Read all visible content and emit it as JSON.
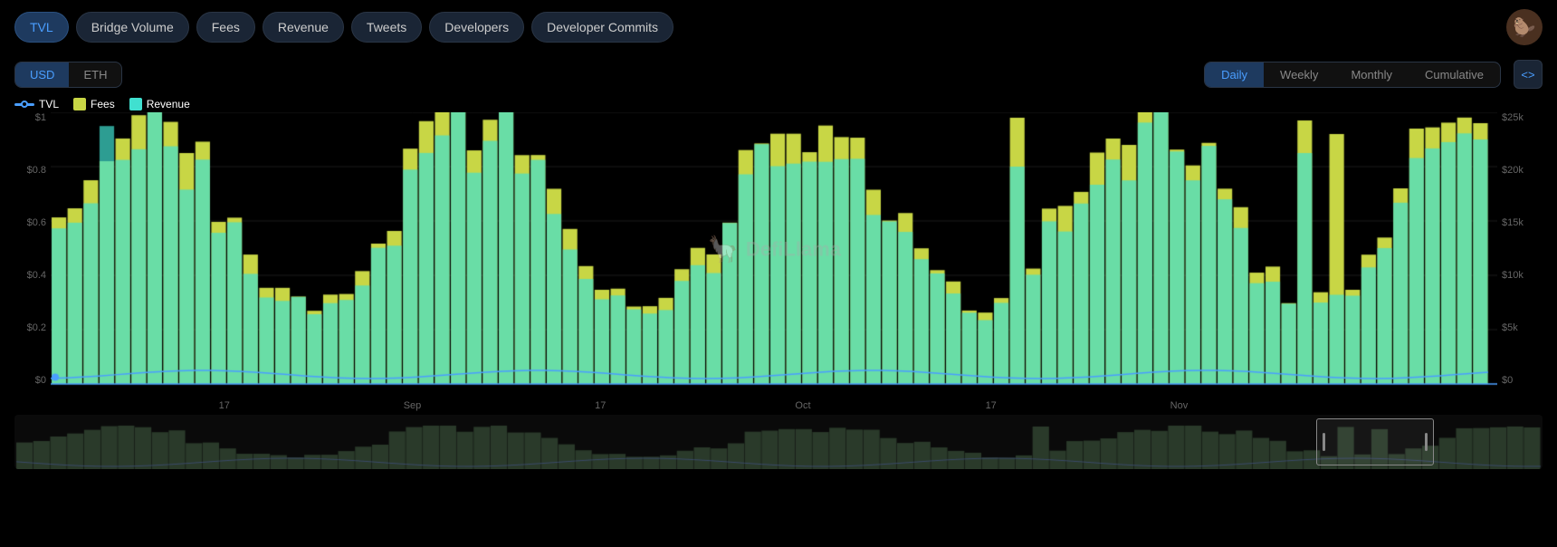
{
  "nav": {
    "items": [
      {
        "label": "TVL",
        "active": true
      },
      {
        "label": "Bridge Volume",
        "active": false
      },
      {
        "label": "Fees",
        "active": false
      },
      {
        "label": "Revenue",
        "active": false
      },
      {
        "label": "Tweets",
        "active": false
      },
      {
        "label": "Developers",
        "active": false
      },
      {
        "label": "Developer Commits",
        "active": false
      }
    ]
  },
  "currency": {
    "options": [
      "USD",
      "ETH"
    ],
    "active": "USD"
  },
  "timeframe": {
    "options": [
      "Daily",
      "Weekly",
      "Monthly",
      "Cumulative"
    ],
    "active": "Daily"
  },
  "legend": [
    {
      "label": "TVL",
      "type": "line",
      "color": "#4a9eff"
    },
    {
      "label": "Fees",
      "type": "bar",
      "color": "#c8d645"
    },
    {
      "label": "Revenue",
      "type": "bar",
      "color": "#40e0d0"
    }
  ],
  "yaxis_left": [
    "$1",
    "$0.8",
    "$0.6",
    "$0.4",
    "$0.2",
    "$0"
  ],
  "yaxis_right": [
    "$25k",
    "$20k",
    "$15k",
    "$10k",
    "$5k",
    "$0"
  ],
  "xaxis": [
    {
      "label": "17",
      "pct": 12
    },
    {
      "label": "Sep",
      "pct": 25
    },
    {
      "label": "17",
      "pct": 38
    },
    {
      "label": "Oct",
      "pct": 52
    },
    {
      "label": "17",
      "pct": 65
    },
    {
      "label": "Nov",
      "pct": 78
    }
  ],
  "watermark": "DefiLlama",
  "code_btn": "<>"
}
